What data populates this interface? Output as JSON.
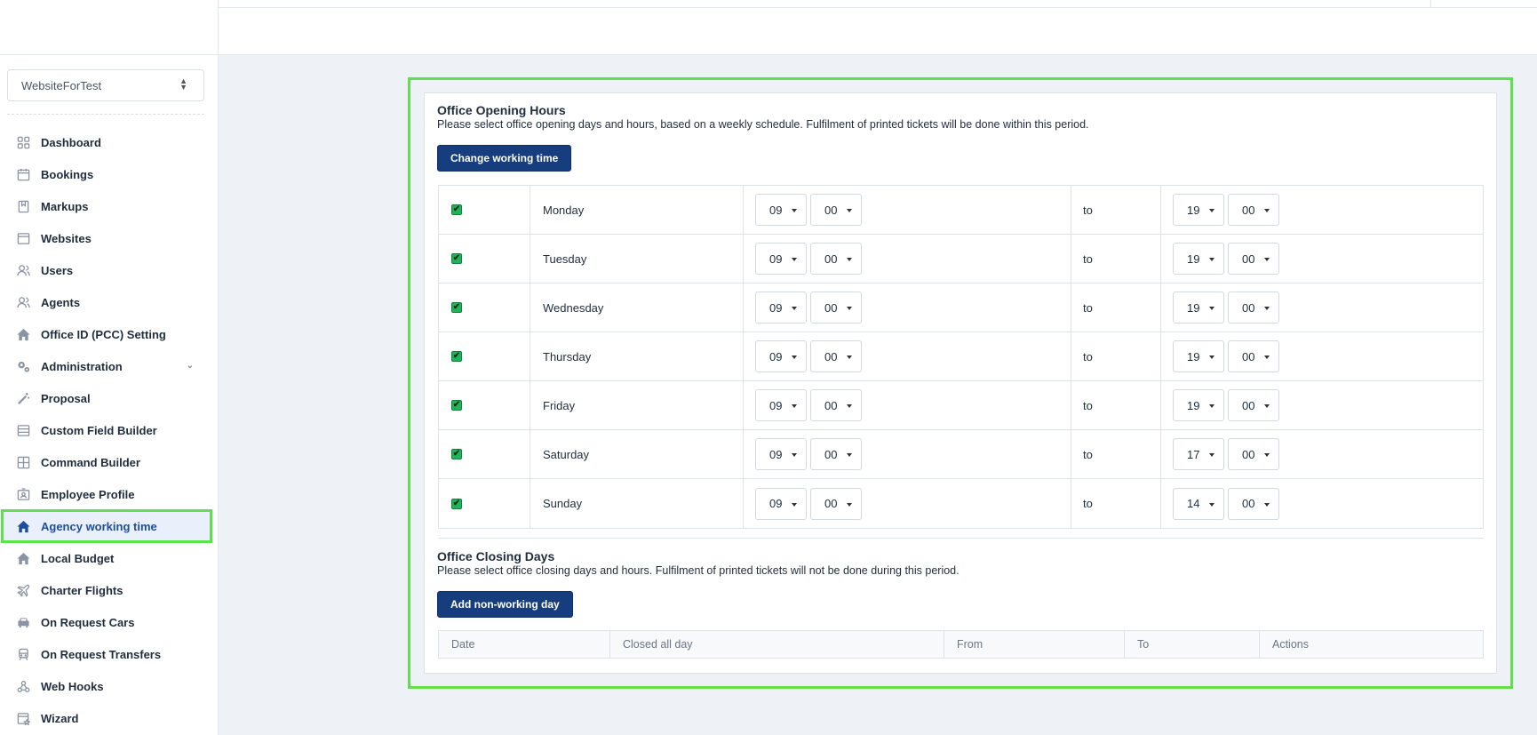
{
  "sidebar": {
    "site_select": "WebsiteForTest",
    "items": [
      {
        "label": "Dashboard",
        "icon": "dashboard-icon"
      },
      {
        "label": "Bookings",
        "icon": "calendar-icon"
      },
      {
        "label": "Markups",
        "icon": "bookmark-icon"
      },
      {
        "label": "Websites",
        "icon": "browser-icon"
      },
      {
        "label": "Users",
        "icon": "users-icon"
      },
      {
        "label": "Agents",
        "icon": "agents-icon"
      },
      {
        "label": "Office ID (PCC) Setting",
        "icon": "home-icon"
      },
      {
        "label": "Administration",
        "icon": "gears-icon"
      },
      {
        "label": "Proposal",
        "icon": "wand-icon"
      },
      {
        "label": "Custom Field Builder",
        "icon": "list-icon"
      },
      {
        "label": "Command Builder",
        "icon": "grid-icon"
      },
      {
        "label": "Employee Profile",
        "icon": "id-card-icon"
      },
      {
        "label": "Agency working time",
        "icon": "home-icon"
      },
      {
        "label": "Local Budget",
        "icon": "home-icon"
      },
      {
        "label": "Charter Flights",
        "icon": "plane-icon"
      },
      {
        "label": "On Request Cars",
        "icon": "car-icon"
      },
      {
        "label": "On Request Transfers",
        "icon": "train-icon"
      },
      {
        "label": "Web Hooks",
        "icon": "webhook-icon"
      },
      {
        "label": "Wizard",
        "icon": "wizard-icon"
      }
    ],
    "active": "Agency working time"
  },
  "opening": {
    "title": "Office Opening Hours",
    "description": "Please select office opening days and hours, based on a weekly schedule. Fulfilment of printed tickets will be done within this period.",
    "button": "Change working time",
    "to_label": "to",
    "days": [
      {
        "day": "Monday",
        "from_h": "09",
        "from_m": "00",
        "to_h": "19",
        "to_m": "00",
        "checked": true
      },
      {
        "day": "Tuesday",
        "from_h": "09",
        "from_m": "00",
        "to_h": "19",
        "to_m": "00",
        "checked": true
      },
      {
        "day": "Wednesday",
        "from_h": "09",
        "from_m": "00",
        "to_h": "19",
        "to_m": "00",
        "checked": true
      },
      {
        "day": "Thursday",
        "from_h": "09",
        "from_m": "00",
        "to_h": "19",
        "to_m": "00",
        "checked": true
      },
      {
        "day": "Friday",
        "from_h": "09",
        "from_m": "00",
        "to_h": "19",
        "to_m": "00",
        "checked": true
      },
      {
        "day": "Saturday",
        "from_h": "09",
        "from_m": "00",
        "to_h": "17",
        "to_m": "00",
        "checked": true
      },
      {
        "day": "Sunday",
        "from_h": "09",
        "from_m": "00",
        "to_h": "14",
        "to_m": "00",
        "checked": true
      }
    ]
  },
  "closing": {
    "title": "Office Closing Days",
    "description": "Please select office closing days and hours. Fulfilment of printed tickets will not be done during this period.",
    "button": "Add non-working day",
    "columns": [
      "Date",
      "Closed all day",
      "From",
      "To",
      "Actions"
    ]
  },
  "colors": {
    "accent": "#163e7e",
    "highlight": "#5fe04d",
    "checkbox": "#1fb45a"
  }
}
